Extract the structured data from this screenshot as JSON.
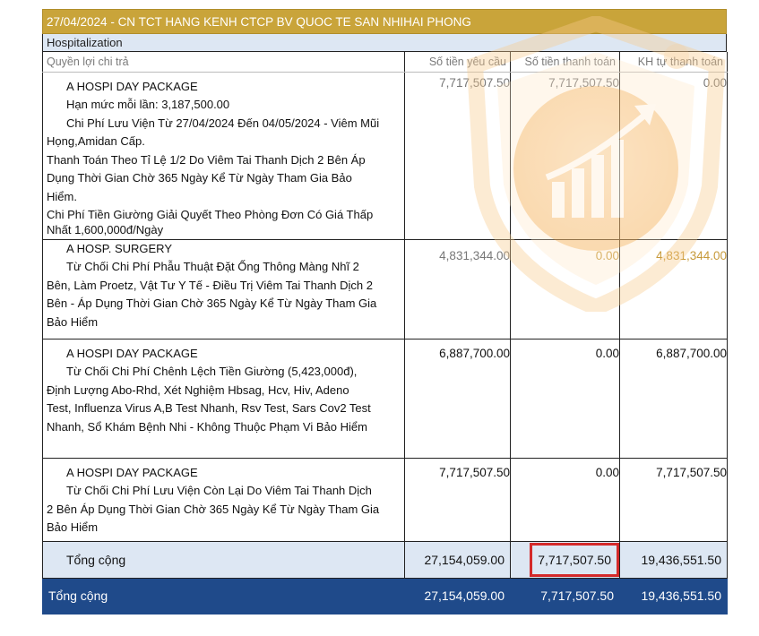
{
  "header": {
    "title": "27/04/2024 - CN TCT HANG KENH CTCP BV QUOC TE SAN NHIHAI PHONG",
    "section": "Hospitalization"
  },
  "columns": {
    "benefit": "Quyền lợi chi trả",
    "requested": "Số tiền yêu cầu",
    "paid": "Số tiền thanh toán",
    "customer_paid": "KH tự thanh toán"
  },
  "rows": [
    {
      "package": "A HOSPI DAY PACKAGE",
      "limit": "Hạn mức mỗi lần: 3,187,500.00",
      "line1": "Chi Phí Lưu Viện Từ 27/04/2024 Đến 04/05/2024 - Viêm Mũi",
      "line2": "Họng,Amidan Cấp.",
      "line3": "Thanh Toán Theo Tỉ Lệ 1/2 Do Viêm Tai Thanh Dịch 2 Bên Áp",
      "line4": "Dụng Thời Gian Chờ 365 Ngày Kể Từ Ngày Tham Gia Bảo",
      "line5": "Hiểm.",
      "line6": "Chi Phí Tiền Giường Giải Quyết Theo Phòng Đơn Có Giá Thấp",
      "line7": "Nhất 1,600,000đ/Ngày",
      "requested": "7,717,507.50",
      "paid": "7,717,507.50",
      "customer_paid": "0.00"
    },
    {
      "package": "A HOSP. SURGERY",
      "line1": "Từ Chối Chi Phí Phẫu Thuật Đặt Ống Thông Màng Nhĩ 2",
      "line2": "Bên, Làm Proetz, Vật Tư Y Tế - Điều Trị Viêm Tai Thanh Dịch 2",
      "line3": "Bên - Áp Dụng Thời Gian Chờ 365 Ngày Kể Từ Ngày Tham Gia",
      "line4": "Bảo Hiểm",
      "requested": "4,831,344.00",
      "paid": "0.00",
      "customer_paid": "4,831,344.00"
    },
    {
      "package": "A HOSPI DAY PACKAGE",
      "line1": "Từ Chối Chi Phí Chênh Lệch Tiền Giường (5,423,000đ),",
      "line2": "Định Lượng Abo-Rhd, Xét Nghiệm Hbsag, Hcv, Hiv, Adeno",
      "line3": "Test, Influenza Virus A,B Test Nhanh, Rsv Test, Sars Cov2 Test",
      "line4": "Nhanh, Sổ Khám Bệnh Nhi - Không Thuộc Phạm Vi Bảo Hiểm",
      "requested": "6,887,700.00",
      "paid": "0.00",
      "customer_paid": "6,887,700.00"
    },
    {
      "package": "A HOSPI DAY PACKAGE",
      "line1": "Từ Chối Chi Phí Lưu Viện Còn Lại Do Viêm Tai Thanh Dịch",
      "line2": "2 Bên Áp Dụng Thời Gian Chờ 365 Ngày Kể Từ Ngày Tham Gia",
      "line3": "Bảo Hiểm",
      "requested": "7,717,507.50",
      "paid": "0.00",
      "customer_paid": "7,717,507.50"
    }
  ],
  "subtotal": {
    "label": "Tổng cộng",
    "requested": "27,154,059.00",
    "paid": "7,717,507.50",
    "customer_paid": "19,436,551.50"
  },
  "grand_total": {
    "label": "Tổng cộng",
    "requested": "27,154,059.00",
    "paid": "7,717,507.50",
    "customer_paid": "19,436,551.50"
  },
  "colors": {
    "header_bg": "#c9a43a",
    "section_bg": "#dde7f3",
    "total_bg": "#1f4a8a",
    "highlight": "#d42a2a",
    "watermark": "#f2a23a"
  },
  "icons": {
    "watermark": "shield-growth-chart-icon"
  }
}
